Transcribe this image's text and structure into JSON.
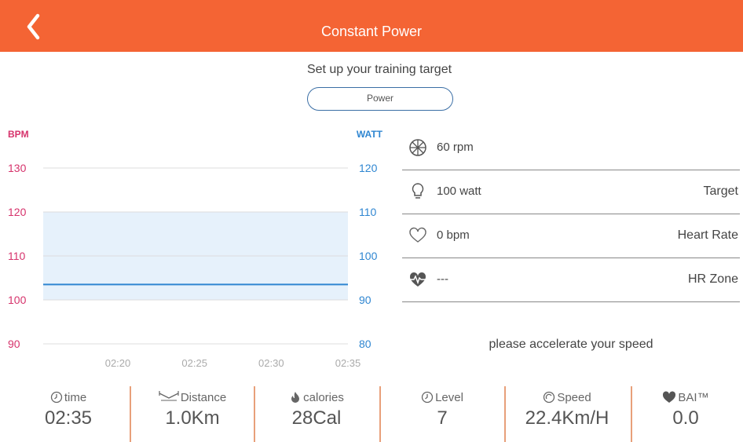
{
  "header": {
    "title": "Constant Power"
  },
  "setup": {
    "prompt": "Set up your training target",
    "target_button": "Power"
  },
  "colors": {
    "accent": "#f46434",
    "bpm": "#d6336c",
    "watt": "#2f86d1",
    "band": "#e6f1fb",
    "line": "#2f86d1"
  },
  "chart_data": {
    "type": "line",
    "left_axis": {
      "label": "BPM",
      "ticks": [
        130,
        120,
        110,
        100,
        90
      ],
      "range": [
        90,
        130
      ]
    },
    "right_axis": {
      "label": "WATT",
      "ticks": [
        120,
        110,
        100,
        90,
        80
      ],
      "range": [
        80,
        120
      ]
    },
    "x_ticks": [
      "02:20",
      "02:25",
      "02:30",
      "02:35"
    ],
    "target_band_bpm": [
      100,
      120
    ],
    "series": [
      {
        "values_watt": [
          93.5,
          93.5
        ]
      }
    ]
  },
  "metrics": [
    {
      "icon": "cadence-wheel-icon",
      "value": "60 rpm",
      "label": ""
    },
    {
      "icon": "bulb-icon",
      "value": "100 watt",
      "label": "Target"
    },
    {
      "icon": "heart-outline-icon",
      "value": "0 bpm",
      "label": "Heart Rate"
    },
    {
      "icon": "heart-pulse-icon",
      "value": "---",
      "label": "HR Zone"
    }
  ],
  "hint": "please accelerate your speed",
  "stats": [
    {
      "icon": "clock-icon",
      "label": "time",
      "value": "02:35"
    },
    {
      "icon": "distance-icon",
      "label": "Distance",
      "value": "1.0Km"
    },
    {
      "icon": "flame-icon",
      "label": "calories",
      "value": "28Cal"
    },
    {
      "icon": "clock-icon",
      "label": "Level",
      "value": "7"
    },
    {
      "icon": "speed-icon",
      "label": "Speed",
      "value": "22.4Km/H"
    },
    {
      "icon": "bai-heart-icon",
      "label": "BAI™",
      "value": "0.0"
    }
  ]
}
